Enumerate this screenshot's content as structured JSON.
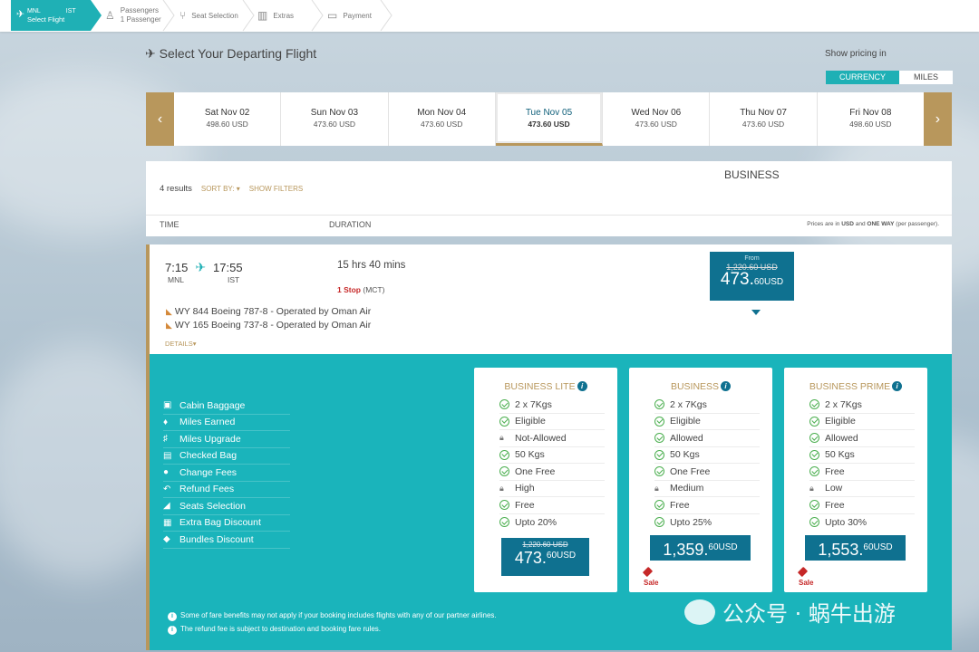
{
  "stepper": {
    "active": {
      "from": "MNL",
      "to": "IST",
      "label": "Select Flight"
    },
    "steps": [
      {
        "label": "Passengers",
        "sub": "1 Passenger",
        "icon": "person-icon"
      },
      {
        "label": "Seat Selection",
        "icon": "seat-icon"
      },
      {
        "label": "Extras",
        "icon": "luggage-icon"
      },
      {
        "label": "Payment",
        "icon": "card-icon"
      }
    ]
  },
  "header": {
    "title": "Select Your Departing Flight",
    "pricing_label": "Show pricing in",
    "toggle": {
      "currency": "CURRENCY",
      "miles": "MILES",
      "active": "currency"
    }
  },
  "dates": [
    {
      "day": "Sat Nov 02",
      "price": "498.60 USD"
    },
    {
      "day": "Sun Nov 03",
      "price": "473.60 USD"
    },
    {
      "day": "Mon Nov 04",
      "price": "473.60 USD"
    },
    {
      "day": "Tue Nov 05",
      "price": "473.60 USD",
      "selected": true
    },
    {
      "day": "Wed Nov 06",
      "price": "473.60 USD"
    },
    {
      "day": "Thu Nov 07",
      "price": "473.60 USD"
    },
    {
      "day": "Fri Nov 08",
      "price": "498.60 USD"
    }
  ],
  "results": {
    "count": "4 results",
    "sort_by": "SORT BY: ▾",
    "show_filters": "SHOW FILTERS",
    "cabin": "BUSINESS",
    "col_time": "TIME",
    "col_duration": "DURATION",
    "price_note_a": "Prices are in ",
    "price_note_b": "USD",
    "price_note_c": " and ",
    "price_note_d": "ONE WAY",
    "price_note_e": " (per passenger)."
  },
  "flight": {
    "depart": "7:15",
    "arrive": "17:55",
    "from": "MNL",
    "to": "IST",
    "duration": "15 hrs 40 mins",
    "stops": "1 Stop",
    "via": "(MCT)",
    "segments": [
      "WY 844 Boeing 787-8 - Operated by Oman Air",
      "WY 165 Boeing 737-8 - Operated by Oman Air"
    ],
    "details": "DETAILS▾",
    "from_label": "From",
    "old_price": "1,220.60 USD",
    "price_int": "473.",
    "price_dec": "60",
    "price_cur": "USD"
  },
  "benefits": [
    {
      "label": "Cabin Baggage",
      "icon": "suitcase-icon"
    },
    {
      "label": "Miles Earned",
      "icon": "miles-icon"
    },
    {
      "label": "Miles Upgrade",
      "icon": "upgrade-seat-icon"
    },
    {
      "label": "Checked Bag",
      "icon": "bag-icon"
    },
    {
      "label": "Change Fees",
      "icon": "change-icon"
    },
    {
      "label": "Refund Fees",
      "icon": "refund-icon"
    },
    {
      "label": "Seats Selection",
      "icon": "seat-icon"
    },
    {
      "label": "Extra Bag Discount",
      "icon": "extra-bag-icon"
    },
    {
      "label": "Bundles Discount",
      "icon": "tag-icon"
    }
  ],
  "fares": [
    {
      "name": "BUSINESS LITE",
      "rows": [
        {
          "v": "2 x 7Kgs",
          "t": "ok"
        },
        {
          "v": "Eligible",
          "t": "ok"
        },
        {
          "v": "Not-Allowed",
          "t": "lock"
        },
        {
          "v": "50 Kgs",
          "t": "ok"
        },
        {
          "v": "One Free",
          "t": "ok"
        },
        {
          "v": "High",
          "t": "lock"
        },
        {
          "v": "Free",
          "t": "ok"
        },
        {
          "v": "Upto 20%",
          "t": "ok"
        }
      ],
      "old_price": "1,220.60 USD",
      "price_int": "473.",
      "price_dec": "60",
      "price_cur": "USD",
      "sale": ""
    },
    {
      "name": "BUSINESS",
      "rows": [
        {
          "v": "2 x 7Kgs",
          "t": "ok"
        },
        {
          "v": "Eligible",
          "t": "ok"
        },
        {
          "v": "Allowed",
          "t": "ok"
        },
        {
          "v": "50 Kgs",
          "t": "ok"
        },
        {
          "v": "One Free",
          "t": "ok"
        },
        {
          "v": "Medium",
          "t": "lock"
        },
        {
          "v": "Free",
          "t": "ok"
        },
        {
          "v": "Upto 25%",
          "t": "ok"
        }
      ],
      "old_price": "",
      "price_int": "1,359.",
      "price_dec": "60",
      "price_cur": "USD",
      "sale": "Sale"
    },
    {
      "name": "BUSINESS PRIME",
      "rows": [
        {
          "v": "2 x 7Kgs",
          "t": "ok"
        },
        {
          "v": "Eligible",
          "t": "ok"
        },
        {
          "v": "Allowed",
          "t": "ok"
        },
        {
          "v": "50 Kgs",
          "t": "ok"
        },
        {
          "v": "Free",
          "t": "ok"
        },
        {
          "v": "Low",
          "t": "lock"
        },
        {
          "v": "Free",
          "t": "ok"
        },
        {
          "v": "Upto 30%",
          "t": "ok"
        }
      ],
      "old_price": "",
      "price_int": "1,553.",
      "price_dec": "60",
      "price_cur": "USD",
      "sale": "Sale"
    }
  ],
  "notes": [
    "Some of fare benefits may not apply if your booking includes flights with any of our partner airlines.",
    "The refund fee is subject to destination and booking fare rules."
  ],
  "watermark": "公众号 · 蜗牛出游",
  "colors": {
    "teal": "#1ab4bb",
    "gold": "#b8975c",
    "navy": "#0f7190",
    "sale": "#c62828"
  }
}
